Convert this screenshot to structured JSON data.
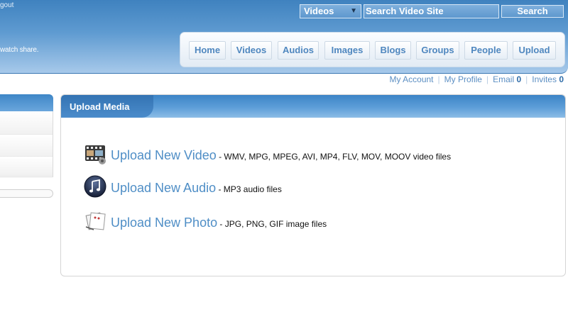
{
  "header": {
    "logout_text": "gout",
    "tagline": "watch share.",
    "search": {
      "category": "Videos",
      "placeholder": "Search Video Site",
      "button": "Search"
    },
    "nav": [
      "Home",
      "Videos",
      "Audios",
      "Images",
      "Blogs",
      "Groups",
      "People",
      "Upload"
    ]
  },
  "account": {
    "my_account": "My Account",
    "my_profile": "My Profile",
    "email_label": "Email",
    "email_count": "0",
    "invites_label": "Invites",
    "invites_count": "0"
  },
  "panel": {
    "title": "Upload Media",
    "items": [
      {
        "link": "Upload New Video",
        "desc": " - WMV, MPG, MPEG, AVI, MP4, FLV, MOV, MOOV video files",
        "icon": "film-strip-icon"
      },
      {
        "link": "Upload New Audio",
        "desc": " - MP3 audio files",
        "icon": "music-note-icon"
      },
      {
        "link": "Upload New Photo",
        "desc": " - JPG, PNG, GIF image files",
        "icon": "photo-stack-icon"
      }
    ]
  },
  "colors": {
    "header_blue": "#3f82bf",
    "link_blue": "#4f8ec6",
    "nav_text": "#4f87bf"
  }
}
